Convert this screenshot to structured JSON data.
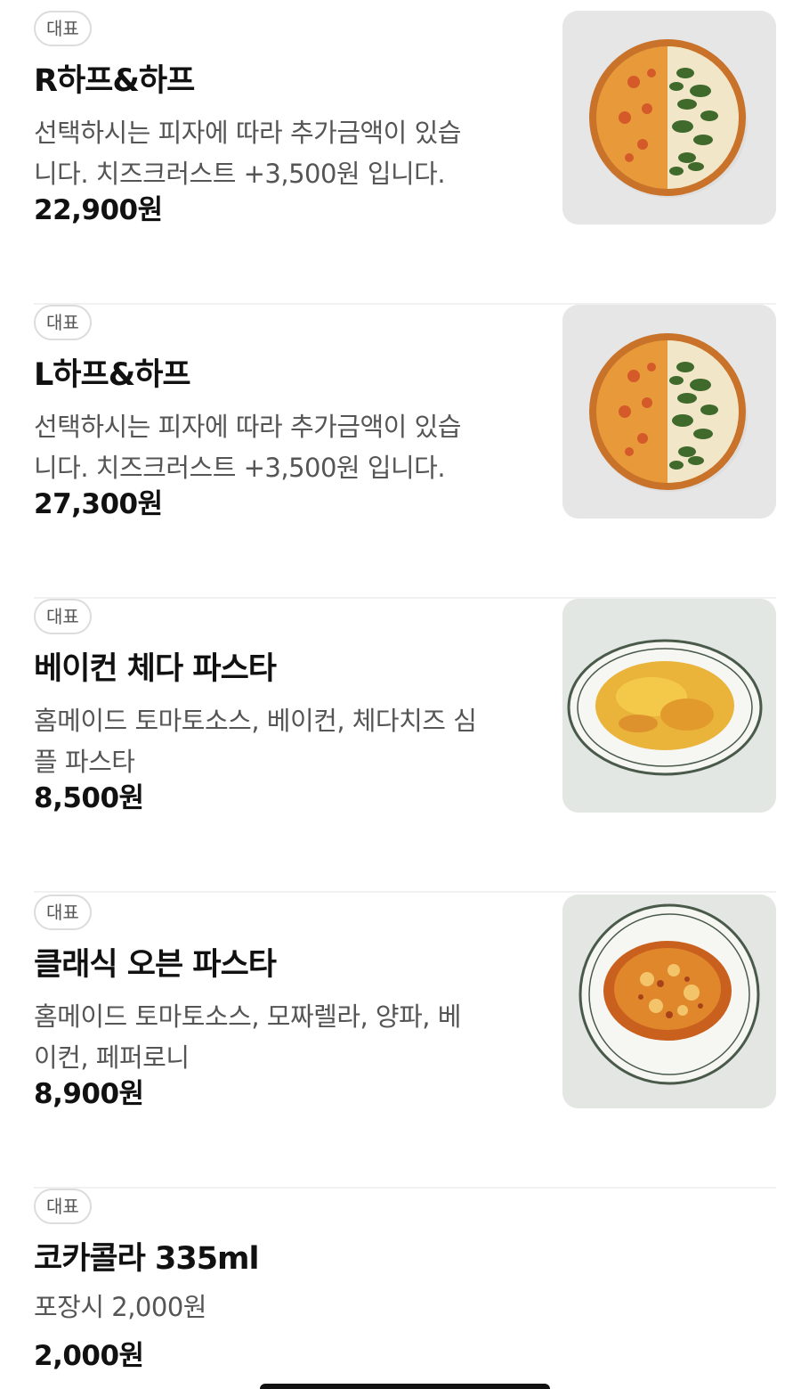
{
  "menu": {
    "items": [
      {
        "badge": "대표",
        "name": "R하프&하프",
        "description": "선택하시는 피자에 따라 추가금액이 있습\n니다. 치즈크러스트 +3,500원 입니다.",
        "price": "22,900원",
        "image": "half-and-half-pizza"
      },
      {
        "badge": "대표",
        "name": "L하프&하프",
        "description": "선택하시는 피자에 따라 추가금액이 있습\n니다. 치즈크러스트 +3,500원 입니다.",
        "price": "27,300원",
        "image": "half-and-half-pizza"
      },
      {
        "badge": "대표",
        "name": "베이컨 체다 파스타",
        "description": "홈메이드 토마토소스, 베이컨, 체다치즈 심\n플 파스타",
        "price": "8,500원",
        "image": "oval-baked-pasta"
      },
      {
        "badge": "대표",
        "name": "클래식 오븐 파스타",
        "description": "홈메이드 토마토소스, 모짜렐라, 양파, 베\n이컨, 페퍼로니",
        "price": "8,900원",
        "image": "round-baked-pasta"
      },
      {
        "badge": "대표",
        "name": "코카콜라 335ml",
        "description": "포장시 2,000원",
        "price": "2,000원"
      }
    ]
  },
  "colors": {
    "text_primary": "#111111",
    "text_secondary": "#555555",
    "badge_border": "#dcdcdc",
    "divider": "#f1f1f1",
    "thumb_bg": "#e5e5e5"
  }
}
